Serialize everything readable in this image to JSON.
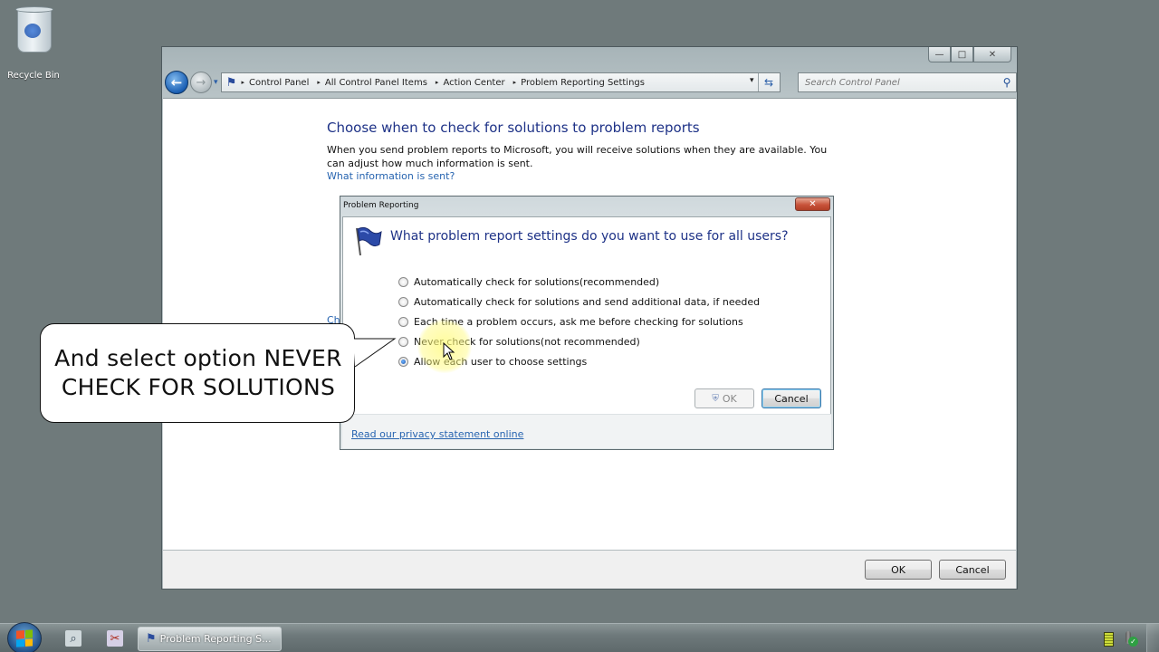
{
  "desktop": {
    "icons": [
      {
        "label": "Recycle Bin",
        "icon": "recycle-bin-icon"
      }
    ]
  },
  "window": {
    "controls": {
      "minimize": "—",
      "maximize": "□",
      "close": "✕"
    },
    "nav": {
      "back_icon": "←",
      "forward_icon": "→",
      "history_icon": "▾"
    },
    "address": {
      "location_icon": "action-center-flag-icon",
      "breadcrumbs": [
        "Control Panel",
        "All Control Panel Items",
        "Action Center",
        "Problem Reporting Settings"
      ],
      "separator": "▸",
      "dropdown_icon": "▾",
      "refresh_icon": "⇆"
    },
    "search": {
      "placeholder": "Search Control Panel",
      "value": "",
      "icon": "⚲"
    },
    "content": {
      "heading": "Choose when to check for solutions to problem reports",
      "description": "When you send problem reports to Microsoft, you will receive solutions when they are available. You can adjust how much information is sent.",
      "link": "What information is sent?",
      "partial_link": "Ch"
    },
    "footer": {
      "ok_label": "OK",
      "cancel_label": "Cancel"
    }
  },
  "dialog": {
    "title": "Problem Reporting",
    "close_icon": "✕",
    "question": "What problem report settings do you want to use for all users?",
    "options": [
      {
        "label": "Automatically check for solutions(recommended)",
        "checked": false
      },
      {
        "label": "Automatically check for solutions and send additional data, if needed",
        "checked": false
      },
      {
        "label": "Each time a problem occurs, ask me before checking for solutions",
        "checked": false
      },
      {
        "label": "Never check for solutions(not recommended)",
        "checked": false
      },
      {
        "label": "Allow each user to choose settings",
        "checked": true
      }
    ],
    "ok_label": "OK",
    "ok_enabled": false,
    "cancel_label": "Cancel",
    "privacy_link": "Read our privacy statement online"
  },
  "callout": {
    "line1": "And select option NEVER",
    "line2": "CHECK FOR SOLUTIONS"
  },
  "taskbar": {
    "start_icon": "windows-logo",
    "pinned": [
      {
        "name": "remote-assistance",
        "glyph": "⌕"
      },
      {
        "name": "snipping-tool",
        "glyph": "✂"
      }
    ],
    "tasks": [
      {
        "label": "Problem Reporting S...",
        "icon": "action-center-flag-icon",
        "active": true
      }
    ],
    "tray": {
      "battery": "battery-icon",
      "network": "network-ok-icon",
      "network_glyph": "✓"
    }
  }
}
